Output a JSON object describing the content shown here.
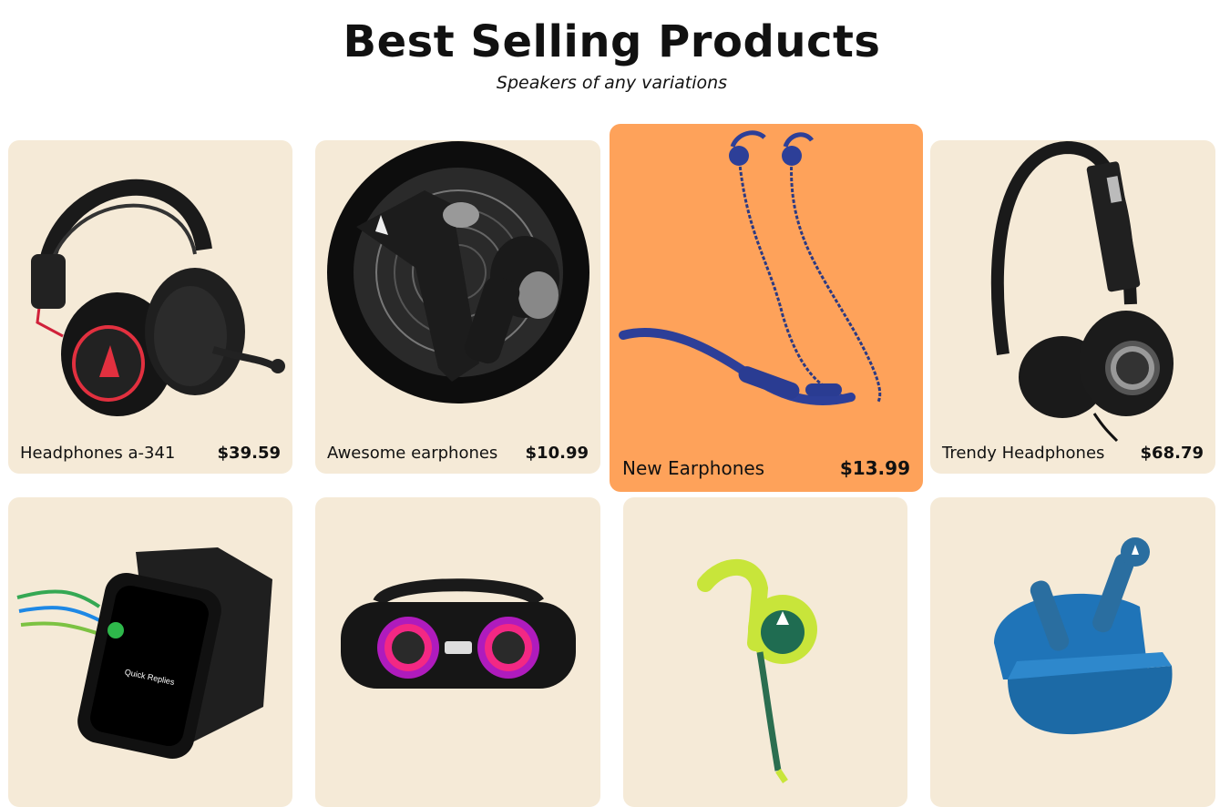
{
  "header": {
    "title": "Best Selling Products",
    "subtitle": "Speakers of any variations"
  },
  "colors": {
    "card_bg": "#f5ead7",
    "featured_bg": "#fea25a",
    "text": "#111111"
  },
  "products": [
    {
      "name": "Headphones a-341",
      "price": "$39.59",
      "icon": "gaming-headset-icon"
    },
    {
      "name": "Awesome earphones",
      "price": "$10.99",
      "icon": "wireless-earbuds-icon"
    },
    {
      "name": "New Earphones",
      "price": "$13.99",
      "icon": "neckband-earphones-icon",
      "featured": true
    },
    {
      "name": "Trendy Headphones",
      "price": "$68.79",
      "icon": "on-ear-headphones-icon"
    },
    {
      "name": "",
      "price": "",
      "icon": "smartwatch-icon"
    },
    {
      "name": "",
      "price": "",
      "icon": "bluetooth-speaker-icon"
    },
    {
      "name": "",
      "price": "",
      "icon": "sports-earphone-icon"
    },
    {
      "name": "",
      "price": "",
      "icon": "earbuds-case-icon"
    }
  ]
}
